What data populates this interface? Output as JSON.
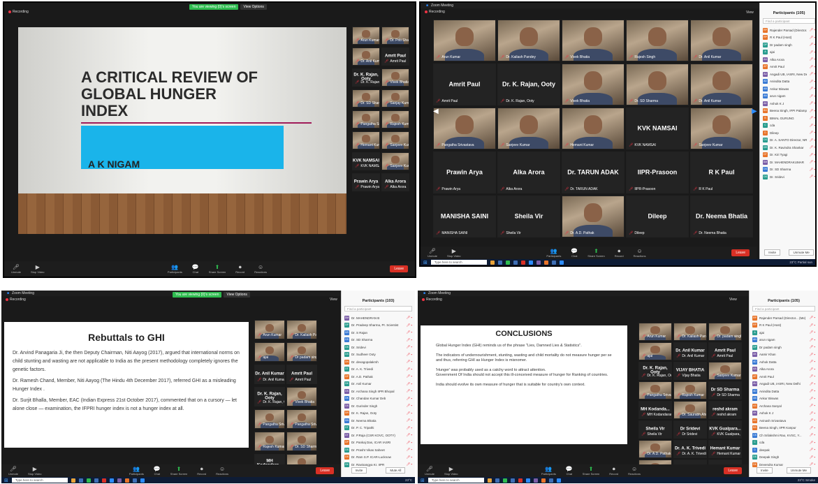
{
  "common": {
    "recording": "Recording",
    "share_banner": "You are viewing {0}'s screen",
    "view_options": "View Options",
    "view": "View",
    "window_title": "Zoom Meeting",
    "search_taskbar": "Type here to search",
    "weather": "23°C",
    "controls": [
      "Unmute",
      "Stop Video",
      "Participants",
      "Chat",
      "Share Screen",
      "Record",
      "Reactions"
    ],
    "end": "Leave",
    "participants_title": "Participants (105)",
    "find": "Find a participant",
    "invite": "Invite",
    "mute_me": "Unmute Me"
  },
  "q1": {
    "slide_title": "A CRITICAL REVIEW OF GLOBAL HUNGER INDEX",
    "author": "A K NIGAM",
    "tiles": [
      {
        "big": "",
        "name": "Arun Kumar"
      },
      {
        "big": "",
        "name": "Dr. Priti Sharma"
      },
      {
        "big": "",
        "name": "Dr. Anil Kumar"
      },
      {
        "big": "Amrit Paul",
        "name": "Amrit Paul"
      },
      {
        "big": "Dr. K. Rajan, Ooty",
        "name": "Dr. K. Rajan, Ooty"
      },
      {
        "big": "",
        "name": "Vivek Bhatia"
      },
      {
        "big": "",
        "name": "Dr. SD Sharma"
      },
      {
        "big": "",
        "name": "Sanjay Kumar"
      },
      {
        "big": "",
        "name": "Pangatha Srivastava"
      },
      {
        "big": "",
        "name": "Rajesh Kumar"
      },
      {
        "big": "",
        "name": "Hemant Kumar"
      },
      {
        "big": "",
        "name": "Sanjeev Kumar"
      },
      {
        "big": "KVK NAMSAI",
        "name": "KVK NAMSAI"
      },
      {
        "big": "",
        "name": "Sanjeev Kumar"
      },
      {
        "big": "Prawin Arya",
        "name": "Prawin Arya"
      },
      {
        "big": "Alka Arora",
        "name": "Alka Arora"
      }
    ]
  },
  "q2": {
    "tiles": [
      {
        "big": "",
        "name": "Arun Kumar"
      },
      {
        "big": "",
        "name": "Dr. Kailash Pandey"
      },
      {
        "big": "",
        "name": "Vivek Bhatia"
      },
      {
        "big": "",
        "name": "Rajesh Singh"
      },
      {
        "big": "",
        "name": "Dr. Anil Kumar"
      },
      {
        "big": "Amrit Paul",
        "name": "Amrit Paul"
      },
      {
        "big": "Dr. K. Rajan, Ooty",
        "name": "Dr. K. Rajan, Ooty"
      },
      {
        "big": "",
        "name": "Vivek Bhatia"
      },
      {
        "big": "",
        "name": "Dr. SD Sharma"
      },
      {
        "big": "",
        "name": "Dr. Anil Kumar"
      },
      {
        "big": "",
        "name": "Pangatha Srivastava"
      },
      {
        "big": "",
        "name": "Sanjeev Kumar"
      },
      {
        "big": "",
        "name": "Hemant Kumar"
      },
      {
        "big": "KVK NAMSAI",
        "name": "KVK NAMSAI"
      },
      {
        "big": "",
        "name": "Sanjeev Kumar"
      },
      {
        "big": "Prawin Arya",
        "name": "Prawin Arya"
      },
      {
        "big": "Alka Arora",
        "name": "Alka Arora"
      },
      {
        "big": "Dr. TARUN ADAK",
        "name": "Dr. TARUN ADAK"
      },
      {
        "big": "IIPR-Prasoon",
        "name": "IIPR-Prasoon"
      },
      {
        "big": "R K Paul",
        "name": "R K Paul"
      },
      {
        "big": "MANISHA SAINI",
        "name": "MANISHA SAINI"
      },
      {
        "big": "Sheila Vir",
        "name": "Sheila Vir"
      },
      {
        "big": "",
        "name": "Dr. A.D. Pathak"
      },
      {
        "big": "Dileep",
        "name": "Dileep"
      },
      {
        "big": "Dr. Neema Bhatia",
        "name": "Dr. Neema Bhatia"
      }
    ],
    "participants": [
      {
        "i": "RP",
        "c": "#e8742a",
        "n": "Rajender Parsad (Director... (Me)"
      },
      {
        "i": "RP",
        "c": "#e8742a",
        "n": "R K Paul (Host)"
      },
      {
        "i": "DP",
        "c": "#2a9d8f",
        "n": "Dr padam singh"
      },
      {
        "i": "A",
        "c": "#2a9d8f",
        "n": "ajai"
      },
      {
        "i": "AA",
        "c": "#7b5ea7",
        "n": "Alka Arora"
      },
      {
        "i": "AP",
        "c": "#e8742a",
        "n": "Amrit Paul"
      },
      {
        "i": "AU",
        "c": "#7b5ea7",
        "n": "Angadi UB, IASRI, New Delhi"
      },
      {
        "i": "AD",
        "c": "#3a7bd5",
        "n": "Anindita Datta"
      },
      {
        "i": "AB",
        "c": "#3a7bd5",
        "n": "Ankur Biswas"
      },
      {
        "i": "AN",
        "c": "#3a7bd5",
        "n": "arun nigam"
      },
      {
        "i": "AK",
        "c": "#7b5ea7",
        "n": "Ashok K J"
      },
      {
        "i": "BS",
        "c": "#e8742a",
        "n": "Beena Singh, IFPI Palampur"
      },
      {
        "i": "B",
        "c": "#e8742a",
        "n": "BIMAL GURUNG"
      },
      {
        "i": "C",
        "c": "#2a9d8f",
        "n": "cda"
      },
      {
        "i": "D",
        "c": "#e8742a",
        "n": "Dileep"
      },
      {
        "i": "DS",
        "c": "#2a9d8f",
        "n": "Dr. A. SANTO Director, NRCC"
      },
      {
        "i": "DR",
        "c": "#2a9d8f",
        "n": "Dr. K. Ravindra Shankar"
      },
      {
        "i": "DT",
        "c": "#e8742a",
        "n": "Dr. Kiri Tyagi"
      },
      {
        "i": "DM",
        "c": "#7b5ea7",
        "n": "Dr. MAHENDRAKUMAR"
      },
      {
        "i": "DS",
        "c": "#3a7bd5",
        "n": "Dr. SD Sharma"
      },
      {
        "i": "DS",
        "c": "#2a9d8f",
        "n": "Dr. Sridevi"
      }
    ],
    "weather": "23°C  Partial sun"
  },
  "q3": {
    "slide_title": "Rebuttals to GHI",
    "paragraphs": [
      "Dr. Arvind Panagaria Ji, the then Deputy Chairman, Niti Aayog (2017), argued that international norms on child stunting and wasting are not applicable to India as the present methodology completely ignores the genetic factors.",
      "Dr. Ramesh Chand, Member, Niti Aayog (The Hindu 4th December 2017), referred GHI as a misleading Hunger Index .",
      "Dr. Surjit Bhalla, Member, EAC (Indian Express 21st October 2017), commented that on a cursory — let alone close — examination, the IFPRI hunger index is not a hunger index at all."
    ],
    "tiles": [
      {
        "big": "",
        "name": "Arun Kumar"
      },
      {
        "big": "",
        "name": "Dr. Kailash Pandey, Director"
      },
      {
        "big": "",
        "name": "ajai"
      },
      {
        "big": "",
        "name": "Dr padam singh"
      },
      {
        "big": "Dr. Anil Kumar",
        "name": "Dr. Anil Kumar"
      },
      {
        "big": "Amrit Paul",
        "name": "Amrit Paul"
      },
      {
        "big": "Dr. K. Rajan, Ooty",
        "name": "Dr. K. Rajan, Ooty"
      },
      {
        "big": "",
        "name": "Vivek Bhatia"
      },
      {
        "big": "",
        "name": "Pangatha Srivastava"
      },
      {
        "big": "",
        "name": "Pangatha Srivastava"
      },
      {
        "big": "",
        "name": "Rajesh Kumar"
      },
      {
        "big": "",
        "name": "Dr. SD Sharma"
      },
      {
        "big": "MH Kodandara...",
        "name": "MH Kodandaram IIR..."
      },
      {
        "big": "",
        "name": "Dr. Narayana Kumar"
      },
      {
        "big": "",
        "name": "Sanjeev Kumar"
      },
      {
        "big": "Sheila Vir",
        "name": "Sheila Vir"
      }
    ],
    "participants": [
      {
        "i": "DM",
        "c": "#7b5ea7",
        "n": "Dr. MAHENDRAN B"
      },
      {
        "i": "DP",
        "c": "#2a9d8f",
        "n": "Dr. Pradeep Sharma, Pr. Scientist"
      },
      {
        "i": "DR",
        "c": "#3a7bd5",
        "n": "Dr. S Rajan"
      },
      {
        "i": "DS",
        "c": "#3a7bd5",
        "n": "Dr. SD Sharma"
      },
      {
        "i": "DS",
        "c": "#2a9d8f",
        "n": "Dr. Sridevi"
      },
      {
        "i": "DS",
        "c": "#2a9d8f",
        "n": "Dr. Sudheer Ooty"
      },
      {
        "i": "DN",
        "c": "#e8742a",
        "n": "Dr. devagopalakrsh"
      },
      {
        "i": "DT",
        "c": "#2a9d8f",
        "n": "Dr. A. K. Trivedi"
      },
      {
        "i": "DP",
        "c": "#e8742a",
        "n": "Dr. A.D. Pathak"
      },
      {
        "i": "DK",
        "c": "#2a9d8f",
        "n": "Dr. Anil Kumar"
      },
      {
        "i": "DS",
        "c": "#7b5ea7",
        "n": "Dr. Archana Singh IIPR Bhopal"
      },
      {
        "i": "DK",
        "c": "#3a7bd5",
        "n": "Dr. Chandan Kumar Deb"
      },
      {
        "i": "DS",
        "c": "#7b5ea7",
        "n": "Dr. Gurinder Singh"
      },
      {
        "i": "DR",
        "c": "#e8742a",
        "n": "Dr. K. Rajan, Ooty"
      },
      {
        "i": "DN",
        "c": "#3a7bd5",
        "n": "Dr. Neema Bhatia"
      },
      {
        "i": "DT",
        "c": "#2a9d8f",
        "n": "Dr. P. C. Tripathi"
      },
      {
        "i": "DT",
        "c": "#7b5ea7",
        "n": "Dr. P.Raja (CSR KOVC, OOTY)"
      },
      {
        "i": "DP",
        "c": "#e8742a",
        "n": "Dr. Pankaj Das, ICAR IASRI"
      },
      {
        "i": "DS",
        "c": "#2a9d8f",
        "n": "Dr. Prasht Vikas Saheet"
      },
      {
        "i": "DS",
        "c": "#e8742a",
        "n": "Dr. Ram S.P. ICAR-Lucknow"
      },
      {
        "i": "DK",
        "c": "#2a9d8f",
        "n": "Dr. Ravisangya Kr. IIPR"
      }
    ],
    "participants_title": "Participants (103)",
    "mute_all": "Mute All"
  },
  "q4": {
    "slide_title": "CONCLUSIONS",
    "paragraphs": [
      "Global Hunger Index (GHI) reminds us of the phrase \"Lies, Damned Lies & Statistics\".",
      "The indicators of undernourishment, stunting, wasting and child mortality do not measure hunger per se and thus, referring GHI as Hunger Index is misnomer.",
      "'Hunger' was probably used as a catchy word to attract attention.\nGovernment Of India should not accept this ill-conceived measure of hunger for Ranking of countries.",
      "India should evolve its own measure of hunger that is suitable for country's own context."
    ],
    "tiles": [
      {
        "big": "",
        "name": "Arun Kumar"
      },
      {
        "big": "",
        "name": "Dr. Kailash Pandey"
      },
      {
        "big": "",
        "name": "Dr. padam singh"
      },
      {
        "big": "",
        "name": "ajai"
      },
      {
        "big": "Dr. Anil Kumar",
        "name": "Dr. Anil Kumar"
      },
      {
        "big": "Amrit Paul",
        "name": "Amrit Paul"
      },
      {
        "big": "Dr. K. Rajan, Ooty",
        "name": "Dr. K. Rajan, Ooty"
      },
      {
        "big": "VIJAY BHATIA",
        "name": "Vijay Bhatia"
      },
      {
        "big": "",
        "name": "Sanjeev Kumar"
      },
      {
        "big": "",
        "name": "Pangatha Srivastava"
      },
      {
        "big": "",
        "name": "Rajesh Kumar"
      },
      {
        "big": "Dr SD Sharma",
        "name": "Dr SD Sharma"
      },
      {
        "big": "MH Kodanda...",
        "name": "MH Kodandaram IIR..."
      },
      {
        "big": "",
        "name": "Dr. Saurabh Ahmad"
      },
      {
        "big": "reshd akram",
        "name": "reshd akram"
      },
      {
        "big": "Sheila Vir",
        "name": "Sheila Vir"
      },
      {
        "big": "Dr Sridevi",
        "name": "Dr Sridevi"
      },
      {
        "big": "KVK Gualpara...",
        "name": "KVK Gualpara, Dr Sa..."
      },
      {
        "big": "",
        "name": "Dr. A.D. Pathak"
      },
      {
        "big": "Dr. A. K. Trivedi",
        "name": "Dr. A. K. Trivedi"
      },
      {
        "big": "Hemant Kumar",
        "name": "Hemant Kumar"
      },
      {
        "big": "",
        "name": "Sanjeev Kumar"
      },
      {
        "big": "Prawin Arya",
        "name": "Prawin Arya"
      },
      {
        "big": "Alka Arora",
        "name": "Alka Arora"
      }
    ],
    "participants": [
      {
        "i": "RP",
        "c": "#e8742a",
        "n": "Rajender Parsad (Director... (Me)"
      },
      {
        "i": "RP",
        "c": "#e8742a",
        "n": "R K Paul (Host)"
      },
      {
        "i": "A",
        "c": "#2a9d8f",
        "n": "ajai"
      },
      {
        "i": "AN",
        "c": "#3a7bd5",
        "n": "arun nigam"
      },
      {
        "i": "DP",
        "c": "#2a9d8f",
        "n": "Dr padam singh"
      },
      {
        "i": "AK",
        "c": "#7b5ea7",
        "n": "Aamir Khan"
      },
      {
        "i": "AD",
        "c": "#3a7bd5",
        "n": "Ashok Datta"
      },
      {
        "i": "AA",
        "c": "#7b5ea7",
        "n": "Alka Arora"
      },
      {
        "i": "AP",
        "c": "#e8742a",
        "n": "Amrit Paul"
      },
      {
        "i": "AU",
        "c": "#7b5ea7",
        "n": "Angadi UB, IASRI, New Delhi"
      },
      {
        "i": "AD",
        "c": "#3a7bd5",
        "n": "Anindita Datta"
      },
      {
        "i": "AB",
        "c": "#3a7bd5",
        "n": "Ankur Biswas"
      },
      {
        "i": "AS",
        "c": "#e8742a",
        "n": "Archana Sanyal"
      },
      {
        "i": "AK",
        "c": "#7b5ea7",
        "n": "Ashok K J"
      },
      {
        "i": "AS",
        "c": "#e8742a",
        "n": "Avinash Srivastava"
      },
      {
        "i": "BS",
        "c": "#e8742a",
        "n": "Beena Singh, IIPR Kanpur"
      },
      {
        "i": "CS",
        "c": "#3a7bd5",
        "n": "Ch Srilakshmi Rao, KVSC, Y..."
      },
      {
        "i": "C",
        "c": "#2a9d8f",
        "n": "cda"
      },
      {
        "i": "D",
        "c": "#3a7bd5",
        "n": "deepak"
      },
      {
        "i": "DS",
        "c": "#2a9d8f",
        "n": "Deepak Singh"
      },
      {
        "i": "DK",
        "c": "#e8742a",
        "n": "Devendra Kumar"
      }
    ],
    "weather": "23°C  Smoke"
  }
}
